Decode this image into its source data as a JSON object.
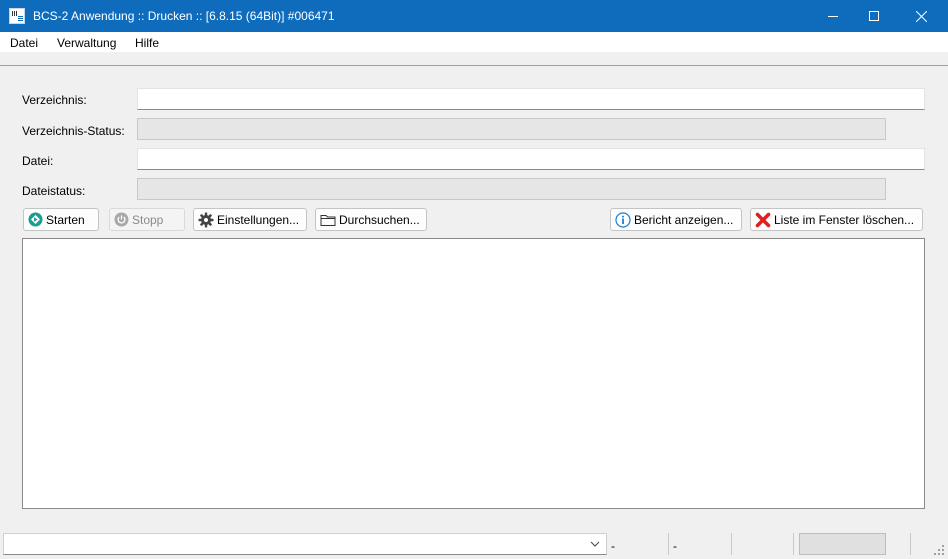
{
  "window": {
    "title": "BCS-2 Anwendung :: Drucken :: [6.8.15 (64Bit)]   #006471"
  },
  "menu": {
    "items": [
      "Datei",
      "Verwaltung",
      "Hilfe"
    ]
  },
  "form": {
    "directory_label": "Verzeichnis:",
    "directory_value": "",
    "directory_status_label": "Verzeichnis-Status:",
    "directory_status_value": "",
    "file_label": "Datei:",
    "file_value": "",
    "file_status_label": "Dateistatus:",
    "file_status_value": ""
  },
  "toolbar": {
    "start_label": "Starten",
    "stop_label": "Stopp",
    "settings_label": "Einstellungen...",
    "browse_label": "Durchsuchen...",
    "report_label": "Bericht anzeigen...",
    "clear_label": "Liste im Fenster löschen..."
  },
  "statusbar": {
    "combo_value": "",
    "panel1": "-",
    "panel2": "-"
  },
  "colors": {
    "titlebar": "#0f6cbd",
    "start_icon": "#1a9e8f",
    "clear_icon": "#e02020",
    "info_icon": "#1a7fd0"
  }
}
